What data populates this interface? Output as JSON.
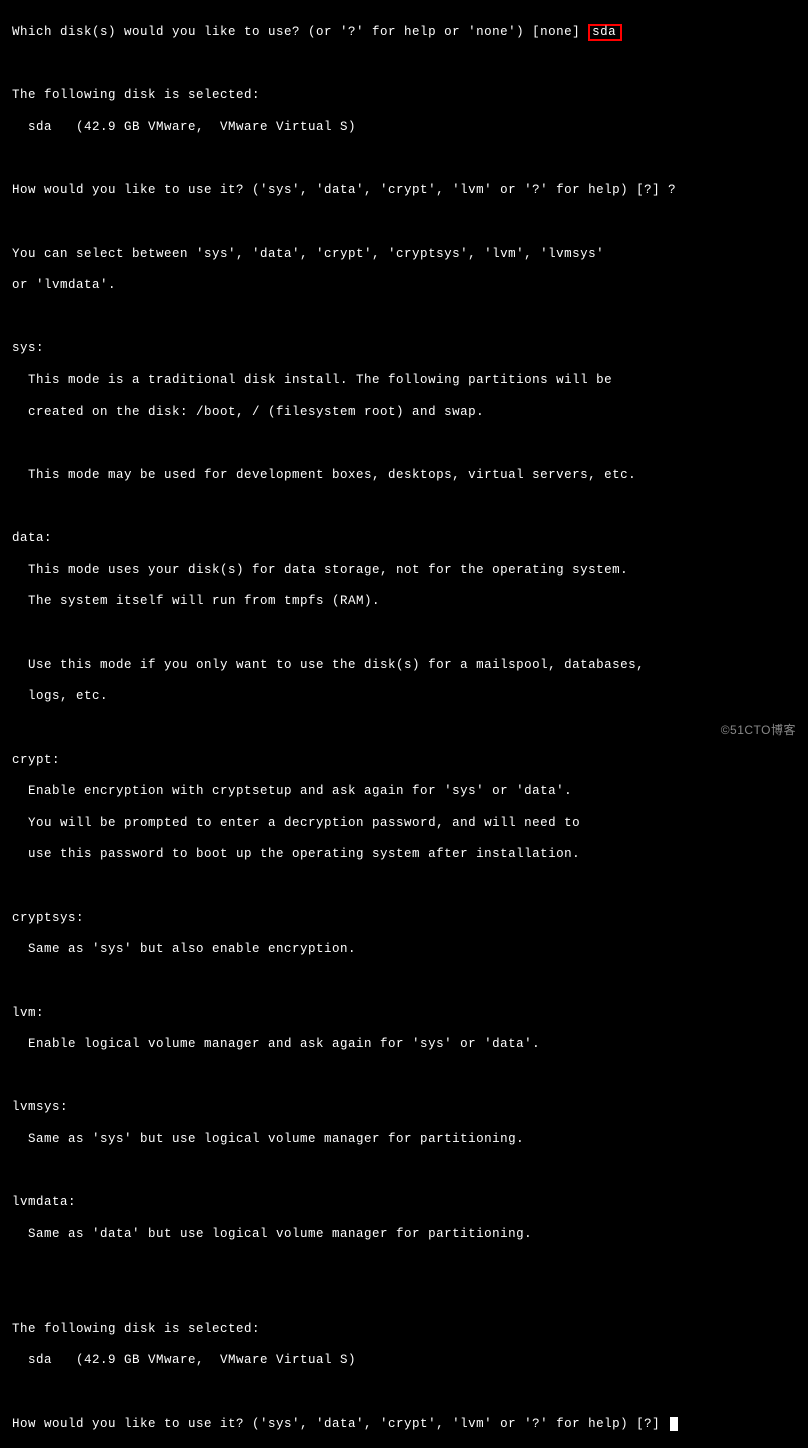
{
  "lines": {
    "l1_prefix": "Which disk(s) would you like to use? (or '?' for help or 'none') [none]",
    "l1_highlight": "sda",
    "l3": "The following disk is selected:",
    "l4": "  sda   (42.9 GB VMware,  VMware Virtual S)",
    "l6": "How would you like to use it? ('sys', 'data', 'crypt', 'lvm' or '?' for help) [?] ?",
    "l8": "You can select between 'sys', 'data', 'crypt', 'cryptsys', 'lvm', 'lvmsys'",
    "l9": "or 'lvmdata'.",
    "l11": "sys:",
    "l12": "  This mode is a traditional disk install. The following partitions will be",
    "l13": "  created on the disk: /boot, / (filesystem root) and swap.",
    "l15": "  This mode may be used for development boxes, desktops, virtual servers, etc.",
    "l17": "data:",
    "l18": "  This mode uses your disk(s) for data storage, not for the operating system.",
    "l19": "  The system itself will run from tmpfs (RAM).",
    "l21": "  Use this mode if you only want to use the disk(s) for a mailspool, databases,",
    "l22": "  logs, etc.",
    "l24": "crypt:",
    "l25": "  Enable encryption with cryptsetup and ask again for 'sys' or 'data'.",
    "l26": "  You will be prompted to enter a decryption password, and will need to",
    "l27": "  use this password to boot up the operating system after installation.",
    "l29": "cryptsys:",
    "l30": "  Same as 'sys' but also enable encryption.",
    "l32": "lvm:",
    "l33": "  Enable logical volume manager and ask again for 'sys' or 'data'.",
    "l35": "lvmsys:",
    "l36": "  Same as 'sys' but use logical volume manager for partitioning.",
    "l38": "lvmdata:",
    "l39": "  Same as 'data' but use logical volume manager for partitioning.",
    "l42": "The following disk is selected:",
    "l43": "  sda   (42.9 GB VMware,  VMware Virtual S)",
    "l45": "How would you like to use it? ('sys', 'data', 'crypt', 'lvm' or '?' for help) [?] "
  },
  "watermark": "©51CTO博客"
}
